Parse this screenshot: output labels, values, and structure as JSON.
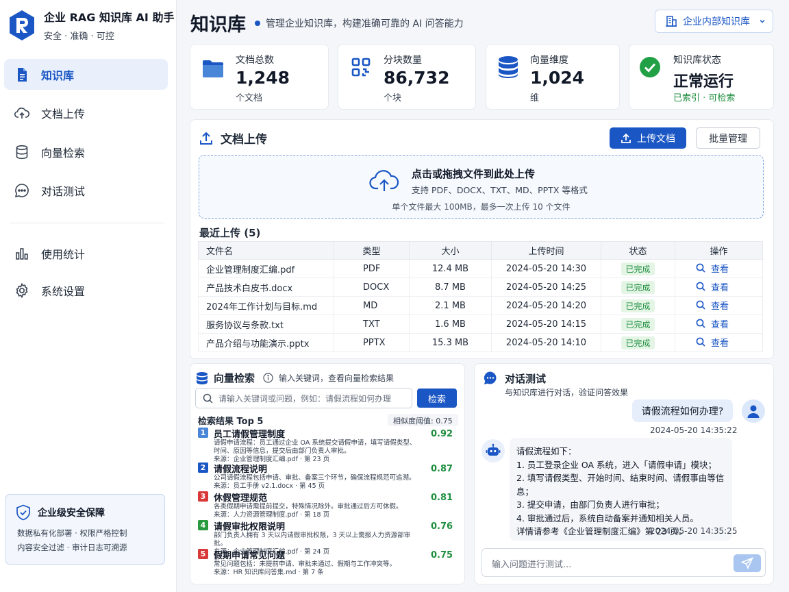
{
  "brand": {
    "title": "企业 RAG 知识库 AI 助手",
    "tagline": "安全 · 准确 · 可控"
  },
  "nav": [
    {
      "label": "知识库",
      "icon": "document-icon"
    },
    {
      "label": "文档上传",
      "icon": "cloud-upload-icon"
    },
    {
      "label": "向量检索",
      "icon": "database-icon"
    },
    {
      "label": "对话测试",
      "icon": "chat-icon"
    },
    {
      "label": "使用统计",
      "icon": "bar-chart-icon"
    },
    {
      "label": "系统设置",
      "icon": "gear-icon"
    }
  ],
  "security": {
    "title": "企业级安全保障",
    "line1": "数据私有化部署 · 权限严格控制",
    "line2": "内容安全过滤 · 审计日志可溯源"
  },
  "header": {
    "title": "知识库",
    "subtitle": "管理企业知识库，构建准确可靠的 AI 问答能力",
    "kb_select": "企业内部知识库"
  },
  "stats": [
    {
      "label": "文档总数",
      "value": "1,248",
      "unit": "个文档"
    },
    {
      "label": "分块数量",
      "value": "86,732",
      "unit": "个块"
    },
    {
      "label": "向量维度",
      "value": "1,024",
      "unit": "维"
    },
    {
      "label": "知识库状态",
      "value": "正常运行",
      "unit": "已索引 · 可检索"
    }
  ],
  "colors": {
    "accent": "#1a56c4",
    "success": "#1e8e3e"
  },
  "upload": {
    "title": "文档上传",
    "upload_btn": "上传文档",
    "batch_btn": "批量管理",
    "drop_main": "点击或拖拽文件到此处上传",
    "drop_sub": "支持 PDF、DOCX、TXT、MD、PPTX 等格式",
    "drop_limit": "单个文件最大 100MB，最多一次上传 10 个文件",
    "recent": "最近上传 (5)"
  },
  "table": {
    "headers": [
      "文件名",
      "类型",
      "大小",
      "上传时间",
      "状态",
      "操作"
    ],
    "rows": [
      {
        "name": "企业管理制度汇编.pdf",
        "type": "PDF",
        "size": "12.4 MB",
        "time": "2024-05-20 14:30",
        "status": "已完成",
        "action": "查看"
      },
      {
        "name": "产品技术白皮书.docx",
        "type": "DOCX",
        "size": "8.7 MB",
        "time": "2024-05-20 14:25",
        "status": "已完成",
        "action": "查看"
      },
      {
        "name": "2024年工作计划与目标.md",
        "type": "MD",
        "size": "2.1 MB",
        "time": "2024-05-20 14:20",
        "status": "已完成",
        "action": "查看"
      },
      {
        "name": "服务协议与条款.txt",
        "type": "TXT",
        "size": "1.6 MB",
        "time": "2024-05-20 14:15",
        "status": "已完成",
        "action": "查看"
      },
      {
        "name": "产品介绍与功能演示.pptx",
        "type": "PPTX",
        "size": "15.3 MB",
        "time": "2024-05-20 14:10",
        "status": "已完成",
        "action": "查看"
      }
    ]
  },
  "vector": {
    "title": "向量检索",
    "hint": "输入关键词，查看向量检索结果",
    "placeholder": "请输入关键词或问题，例如：请假流程如何办理",
    "search_btn": "检索",
    "results_title": "检索结果 Top 5",
    "threshold": "相似度阈值: 0.75",
    "results": [
      {
        "n": "1",
        "title": "员工请假管理制度",
        "score": "0.92",
        "desc": "请假申请流程：员工通过企业 OA 系统提交请假申请，填写请假类型、时间、原因等信息，提交后由部门负责人审批。",
        "src": "来源：企业管理制度汇编.pdf · 第 23 页",
        "color": "#4a86d8"
      },
      {
        "n": "2",
        "title": "请假流程说明",
        "score": "0.87",
        "desc": "公司请假流程包括申请、审批、备案三个环节，确保流程规范可追溯。",
        "src": "来源：员工手册 v2.1.docx · 第 45 页",
        "color": "#1a56c4"
      },
      {
        "n": "3",
        "title": "休假管理规范",
        "score": "0.81",
        "desc": "各类假期申请需提前提交，特殊情况除外。审批通过后方可休假。",
        "src": "来源：人力资源管理制度.pdf · 第 18 页",
        "color": "#d93838"
      },
      {
        "n": "4",
        "title": "请假审批权限说明",
        "score": "0.76",
        "desc": "部门负责人拥有 3 天以内请假审批权限，3 天以上需报人力资源部审批。",
        "src": "来源：企业管理制度汇编.pdf · 第 24 页",
        "color": "#2a9a3e"
      },
      {
        "n": "5",
        "title": "假期申请常见问题",
        "score": "0.75",
        "desc": "常见问题包括：未提前申请、审批未通过、假期与工作冲突等。",
        "src": "来源：HR 知识库问答集.md · 第 7 条",
        "color": "#d93838"
      }
    ]
  },
  "chat": {
    "title": "对话测试",
    "subtitle": "与知识库进行对话，验证问答效果",
    "question": "请假流程如何办理?",
    "q_time": "2024-05-20 14:35:22",
    "answer": [
      "请假流程如下：",
      "1. 员工登录企业 OA 系统，进入「请假申请」模块；",
      "2. 填写请假类型、开始时间、结束时间、请假事由等信息；",
      "3. 提交申请，由部门负责人进行审批；",
      "4. 审批通过后，系统自动备案并通知相关人员。",
      "详情请参考《企业管理制度汇编》第 23 页。"
    ],
    "a_time": "2024-05-20 14:35:25",
    "placeholder": "输入问题进行测试..."
  }
}
